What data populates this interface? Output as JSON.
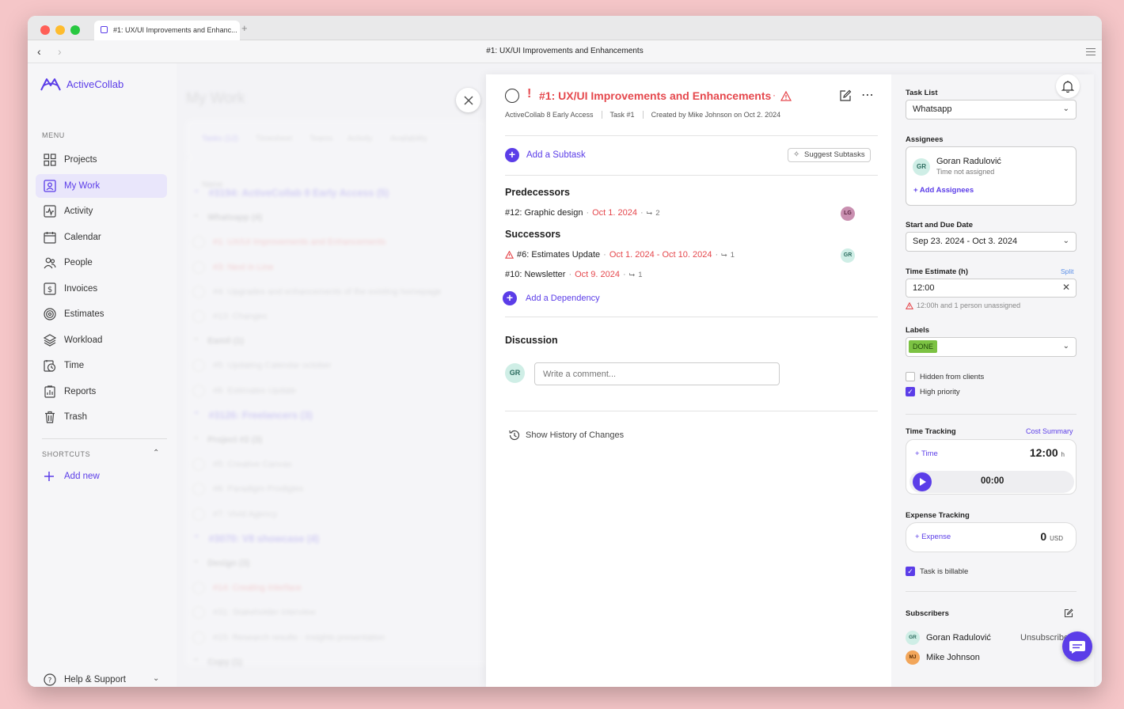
{
  "browser": {
    "tab_title": "#1: UX/UI Improvements and Enhanc...",
    "new_tab": "+",
    "window_title": "#1: UX/UI Improvements and Enhancements"
  },
  "sidebar": {
    "brand": "ActiveCollab",
    "menu_heading": "MENU",
    "items": [
      {
        "label": "Projects",
        "icon": "grid-icon"
      },
      {
        "label": "My Work",
        "icon": "user-card-icon",
        "active": true
      },
      {
        "label": "Activity",
        "icon": "activity-icon"
      },
      {
        "label": "Calendar",
        "icon": "calendar-icon"
      },
      {
        "label": "People",
        "icon": "people-icon"
      },
      {
        "label": "Invoices",
        "icon": "dollar-icon"
      },
      {
        "label": "Estimates",
        "icon": "target-icon"
      },
      {
        "label": "Workload",
        "icon": "layers-icon"
      },
      {
        "label": "Time",
        "icon": "clock-icon"
      },
      {
        "label": "Reports",
        "icon": "reports-icon"
      },
      {
        "label": "Trash",
        "icon": "trash-icon"
      }
    ],
    "shortcuts_heading": "SHORTCUTS",
    "add_new": "Add new",
    "help": "Help & Support"
  },
  "background": {
    "page_title": "My Work",
    "tabs": [
      "Tasks (12)",
      "Timesheet",
      "Teams",
      "Activity",
      "Availability"
    ],
    "column_name": "Name",
    "rows": [
      {
        "text": "#3194: ActiveCollab 8 Early Access (5)",
        "kind": "group"
      },
      {
        "text": "Whatsapp (4)",
        "kind": "sub"
      },
      {
        "text": "#1: UX/UI Improvements and Enhancements",
        "kind": "red"
      },
      {
        "text": "#3: Next in Line",
        "kind": "red"
      },
      {
        "text": "#4: Upgrades and enhancements of the existing homepage",
        "kind": "task"
      },
      {
        "text": "#13: Changes",
        "kind": "task"
      },
      {
        "text": "Eamil (1)",
        "kind": "sub"
      },
      {
        "text": "#5: Updating Calendar october",
        "kind": "task"
      },
      {
        "text": "#6: Estimates Update",
        "kind": "task"
      },
      {
        "text": "#3126: Freelancers (3)",
        "kind": "group"
      },
      {
        "text": "Project #2 (3)",
        "kind": "sub"
      },
      {
        "text": "#5: Creative Canvas",
        "kind": "task"
      },
      {
        "text": "#6: Paradigm Prodigies",
        "kind": "task"
      },
      {
        "text": "#7: Vivid Agency",
        "kind": "task"
      },
      {
        "text": "#3070: V8 showcase (4)",
        "kind": "group"
      },
      {
        "text": "Design (3)",
        "kind": "sub"
      },
      {
        "text": "#14: Creating Interface",
        "kind": "red"
      },
      {
        "text": "#31: Stakeholder interview",
        "kind": "task"
      },
      {
        "text": "#15: Research results - insights presentation",
        "kind": "task"
      },
      {
        "text": "Copy (1)",
        "kind": "sub"
      }
    ]
  },
  "task": {
    "priority_mark": "!",
    "title": "#1: UX/UI Improvements and Enhancements",
    "title_dot": "·",
    "project": "ActiveCollab 8 Early Access",
    "task_no": "Task #1",
    "created": "Created by Mike Johnson on Oct 2. 2024",
    "add_subtask": "Add a Subtask",
    "suggest_subtasks": "Suggest Subtasks",
    "predecessors_heading": "Predecessors",
    "predecessors": [
      {
        "name": "#12: Graphic design",
        "date": "Oct 1. 2024",
        "subtasks": "2",
        "avatar": "LG",
        "warning": false
      }
    ],
    "successors_heading": "Successors",
    "successors": [
      {
        "name": "#6: Estimates Update",
        "date": "Oct 1. 2024 - Oct 10. 2024",
        "subtasks": "1",
        "avatar": "GR",
        "warning": true
      },
      {
        "name": "#10: Newsletter",
        "date": "Oct 9. 2024",
        "subtasks": "1",
        "avatar": "",
        "warning": false
      }
    ],
    "add_dependency": "Add a Dependency",
    "discussion_heading": "Discussion",
    "comment_avatar": "GR",
    "comment_placeholder": "Write a comment...",
    "history": "Show History of Changes"
  },
  "details": {
    "task_list_label": "Task List",
    "task_list_value": "Whatsapp",
    "assignees_label": "Assignees",
    "assignee": {
      "initials": "GR",
      "name": "Goran Radulović",
      "sub": "Time not assigned"
    },
    "add_assignees": "+ Add Assignees",
    "dates_label": "Start and Due Date",
    "dates_value": "Sep 23. 2024 - Oct 3. 2024",
    "estimate_label": "Time Estimate (h)",
    "split": "Split",
    "estimate_value": "12:00",
    "estimate_warning": "12:00h and 1 person unassigned",
    "labels_label": "Labels",
    "label_value": "DONE",
    "hidden_clients": "Hidden from clients",
    "hidden_clients_checked": false,
    "high_priority": "High priority",
    "high_priority_checked": true,
    "time_tracking_label": "Time Tracking",
    "cost_summary": "Cost Summary",
    "add_time": "+ Time",
    "tracked": "12:00",
    "tracked_unit": "h",
    "timer": "00:00",
    "expense_label": "Expense Tracking",
    "add_expense": "+ Expense",
    "expense_value": "0",
    "expense_unit": "USD",
    "billable": "Task is billable",
    "billable_checked": true,
    "subscribers_label": "Subscribers",
    "subscribers": [
      {
        "initials": "GR",
        "name": "Goran Radulović"
      },
      {
        "initials": "MJ",
        "name": "Mike Johnson"
      }
    ],
    "unsubscribe": "Unsubscribe"
  },
  "colors": {
    "accent": "#5b3de8",
    "danger": "#e5484d",
    "label_done": "#7cc243"
  }
}
